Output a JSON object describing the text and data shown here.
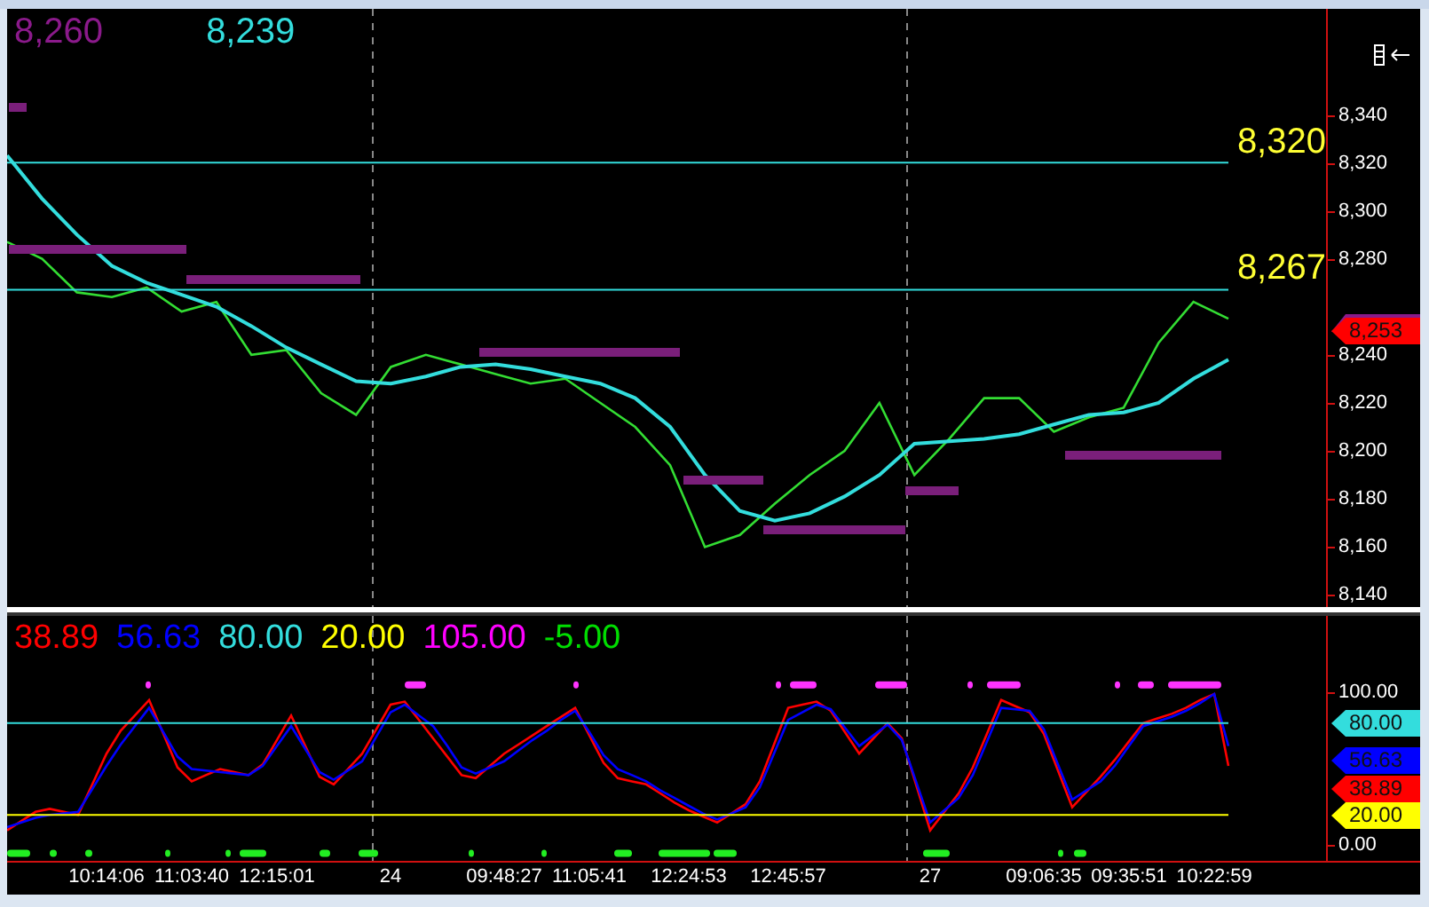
{
  "price_panel": {
    "legend": [
      {
        "text": "8,260",
        "color": "#8b1a8b"
      },
      {
        "text": "8,239",
        "color": "#33dddd"
      }
    ],
    "axis_tags": [
      {
        "text": "8,253",
        "color": "#ff0000"
      }
    ],
    "chart_data": {
      "type": "line",
      "categories": [
        null,
        null,
        null,
        null,
        null,
        null,
        null,
        null,
        null,
        null,
        null,
        null,
        null,
        null,
        null,
        null,
        null,
        null,
        null,
        null,
        null,
        null,
        null,
        null,
        null,
        null,
        null,
        null,
        null,
        null,
        null,
        null,
        null,
        null,
        null,
        null
      ],
      "series": [
        {
          "color": "#33dd33",
          "values": [
            8287,
            8280,
            8266,
            8264,
            8268,
            8258,
            8262,
            8240,
            8242,
            8224,
            8215,
            8235,
            8240,
            8236,
            8232,
            8228,
            8230,
            8220,
            8210,
            8194,
            8160,
            8165,
            8178,
            8190,
            8200,
            8220,
            8190,
            8205,
            8222,
            8222,
            8208,
            8214,
            8218,
            8245,
            8262,
            8255
          ]
        },
        {
          "color": "#33dddd",
          "values": [
            8323,
            8305,
            8290,
            8277,
            8270,
            8265,
            8260,
            8252,
            8243,
            8236,
            8229,
            8228,
            8231,
            8235,
            8236,
            8234,
            8231,
            8228,
            8222,
            8210,
            8190,
            8175,
            8171,
            8174,
            8181,
            8190,
            8203,
            8204,
            8205,
            8207,
            8211,
            8215,
            8216,
            8220,
            8230,
            8238
          ]
        },
        {
          "color": "#33dddd",
          "values": [
            8320,
            8320,
            8320,
            8320,
            8320,
            8320,
            8320,
            8320,
            8320,
            8320,
            8320,
            8320,
            8320,
            8320,
            8320,
            8320,
            8320,
            8320,
            8320,
            8320,
            8320,
            8320,
            8320,
            8320,
            8320,
            8320,
            8320,
            8320,
            8320,
            8320,
            8320,
            8320,
            8320,
            8320,
            8320,
            8320
          ]
        },
        {
          "color": "#33dddd",
          "values": [
            8267,
            8267,
            8267,
            8267,
            8267,
            8267,
            8267,
            8267,
            8267,
            8267,
            8267,
            8267,
            8267,
            8267,
            8267,
            8267,
            8267,
            8267,
            8267,
            8267,
            8267,
            8267,
            8267,
            8267,
            8267,
            8267,
            8267,
            8267,
            8267,
            8267,
            8267,
            8267,
            8267,
            8267,
            8267,
            8267
          ]
        }
      ],
      "ylim": [
        8135,
        8384
      ],
      "yticks": [
        {
          "value": 8140,
          "label": "8,140"
        },
        {
          "value": 8160,
          "label": "8,160"
        },
        {
          "value": 8180,
          "label": "8,180"
        },
        {
          "value": 8200,
          "label": "8,200"
        },
        {
          "value": 8220,
          "label": "8,220"
        },
        {
          "value": 8240,
          "label": "8,240"
        },
        {
          "value": 8280,
          "label": "8,280"
        },
        {
          "value": 8300,
          "label": "8,300"
        },
        {
          "value": 8320,
          "label": "8,320"
        },
        {
          "value": 8340,
          "label": "8,340"
        }
      ],
      "annotations": [
        "8,320",
        "8,267"
      ]
    }
  },
  "oscillator_panel": {
    "legend": [
      {
        "text": "38.89",
        "color": "#ff0000"
      },
      {
        "text": "56.63",
        "color": "#0000ff"
      },
      {
        "text": "80.00",
        "color": "#33dddd"
      },
      {
        "text": "20.00",
        "color": "#ffff00"
      },
      {
        "text": "105.00",
        "color": "#ff00ff"
      },
      {
        "text": "-5.00",
        "color": "#00dd00"
      }
    ],
    "axis_tags": [
      {
        "text": "80.00",
        "color": "#33dddd"
      },
      {
        "text": "56.63",
        "color": "#0000ff"
      },
      {
        "text": "38.89",
        "color": "#ff0000"
      },
      {
        "text": "20.00",
        "color": "#ffff00"
      }
    ],
    "chart_data": {
      "type": "line",
      "categories": [
        null,
        null,
        null,
        null,
        null,
        null,
        null,
        "10:14:06",
        null,
        null,
        null,
        null,
        null,
        "11:03:40",
        null,
        null,
        null,
        null,
        null,
        "12:15:01",
        null,
        null,
        null,
        null,
        null,
        null,
        null,
        "24",
        null,
        null,
        null,
        null,
        null,
        null,
        null,
        "09:48:27",
        null,
        null,
        null,
        null,
        null,
        "11:05:41",
        null,
        null,
        null,
        null,
        null,
        null,
        "12:24:53",
        null,
        null,
        null,
        null,
        null,
        null,
        "12:45:57",
        null,
        null,
        null,
        null,
        null,
        null,
        null,
        null,
        null,
        "27",
        null,
        null,
        null,
        null,
        null,
        null,
        null,
        "09:06:35",
        null,
        null,
        null,
        null,
        null,
        "09:35:51",
        null,
        null,
        null,
        null,
        null,
        "10:22:59",
        null
      ],
      "series": [
        {
          "color": "#ff0000",
          "values": [
            10,
            16,
            22,
            24,
            22,
            20,
            40,
            60,
            75,
            85,
            95,
            73,
            51,
            42,
            46,
            50,
            48,
            46,
            53,
            69,
            85,
            65,
            45,
            40,
            50,
            60,
            76,
            92,
            94,
            82,
            70,
            58,
            46,
            44,
            52,
            60,
            66,
            72,
            78,
            84,
            90,
            72,
            54,
            44,
            42,
            40,
            34,
            28,
            23,
            19,
            15,
            21,
            27,
            42,
            66,
            90,
            92,
            94,
            88,
            74,
            60,
            70,
            80,
            70,
            40,
            10,
            22,
            34,
            51,
            73,
            95,
            91,
            87,
            73,
            49,
            25,
            35,
            45,
            56,
            68,
            80,
            83,
            86,
            90,
            95,
            99,
            52
          ]
        },
        {
          "color": "#0000ff",
          "values": [
            12,
            15,
            18,
            20,
            21,
            22,
            37,
            52,
            66,
            78,
            90,
            74,
            58,
            50,
            49,
            48,
            47,
            46,
            52,
            65,
            78,
            63,
            48,
            43,
            49,
            55,
            71,
            87,
            92,
            85,
            78,
            65,
            51,
            47,
            51,
            55,
            62,
            69,
            75,
            82,
            88,
            74,
            59,
            50,
            46,
            42,
            36,
            31,
            26,
            21,
            17,
            21,
            25,
            38,
            60,
            82,
            87,
            92,
            89,
            77,
            65,
            72,
            79,
            69,
            42,
            15,
            23,
            31,
            46,
            68,
            90,
            89,
            88,
            76,
            53,
            30,
            36,
            42,
            52,
            65,
            78,
            81,
            84,
            88,
            93,
            99,
            65
          ]
        },
        {
          "color": "#33dddd",
          "values": [
            80,
            80,
            80,
            80,
            80,
            80,
            80,
            80,
            80,
            80,
            80,
            80,
            80,
            80,
            80,
            80,
            80,
            80,
            80,
            80,
            80,
            80,
            80,
            80,
            80,
            80,
            80,
            80,
            80,
            80,
            80,
            80,
            80,
            80,
            80,
            80,
            80,
            80,
            80,
            80,
            80,
            80,
            80,
            80,
            80,
            80,
            80,
            80,
            80,
            80,
            80,
            80,
            80,
            80,
            80,
            80,
            80,
            80,
            80,
            80,
            80,
            80,
            80,
            80,
            80,
            80,
            80,
            80,
            80,
            80,
            80,
            80,
            80,
            80,
            80,
            80,
            80,
            80,
            80,
            80,
            80,
            80,
            80,
            80,
            80,
            80,
            80
          ]
        },
        {
          "color": "#ffff00",
          "values": [
            20,
            20,
            20,
            20,
            20,
            20,
            20,
            20,
            20,
            20,
            20,
            20,
            20,
            20,
            20,
            20,
            20,
            20,
            20,
            20,
            20,
            20,
            20,
            20,
            20,
            20,
            20,
            20,
            20,
            20,
            20,
            20,
            20,
            20,
            20,
            20,
            20,
            20,
            20,
            20,
            20,
            20,
            20,
            20,
            20,
            20,
            20,
            20,
            20,
            20,
            20,
            20,
            20,
            20,
            20,
            20,
            20,
            20,
            20,
            20,
            20,
            20,
            20,
            20,
            20,
            20,
            20,
            20,
            20,
            20,
            20,
            20,
            20,
            20,
            20,
            20,
            20,
            20,
            20,
            20,
            20,
            20,
            20,
            20,
            20,
            20,
            20
          ]
        }
      ],
      "ylim": [
        -10,
        150
      ],
      "yticks": [
        {
          "value": 0,
          "label": "0.00"
        },
        {
          "value": 100,
          "label": "100.00"
        }
      ]
    }
  }
}
